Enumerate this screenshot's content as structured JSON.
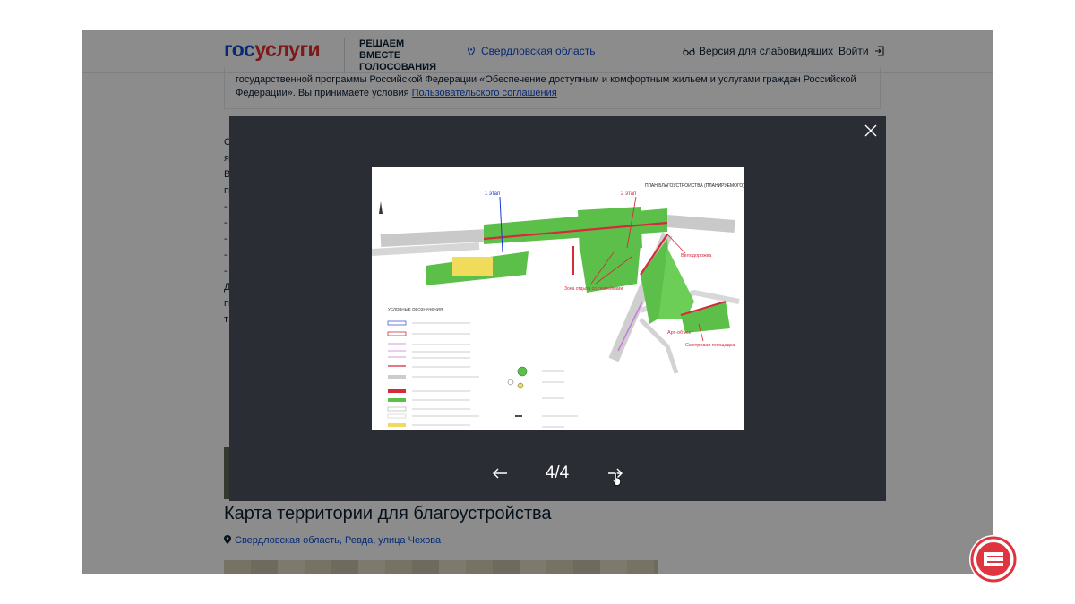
{
  "header": {
    "logo_part1": "гос",
    "logo_part2": "услуги",
    "slogan": "РЕШАЕМ ВМЕСТЕ ГОЛОСОВАНИЯ",
    "region": "Свердловская область",
    "accessibility": "Версия для слабовидящих",
    "login": "Войти"
  },
  "content": {
    "notice_text": "государственной программы Российской Федерации «Обеспечение доступным и комфортным жильем и услугами граждан Российской Федерации». Вы принимаете условия",
    "notice_link": "Пользовательского соглашения",
    "left_letters": [
      "С",
      "я",
      "В",
      "п",
      "-",
      "-",
      "-",
      "-",
      "-",
      "Д",
      "п",
      "т"
    ],
    "section_title": "Карта территории для благоустройства",
    "address": "Свердловская область, Ревда, улица Чехова"
  },
  "viewer": {
    "counter": "4/4",
    "image": {
      "plan_title": "ПЛАН БЛАГОУСТРОЙСТВА (ПЛАНИРУЕМОГО)",
      "stage1": "1 этап",
      "stage2": "2 этап",
      "label_bike": "Велодорожка",
      "label_rest": "Зона отдыха со скамейками",
      "label_art": "Арт-объект",
      "label_view": "Смотровая площадка",
      "legend_title": "УСЛОВНЫЕ ОБОЗНАЧЕНИЯ"
    }
  },
  "colors": {
    "brand_blue": "#0d4cd3",
    "brand_red": "#e52e2e",
    "modal_bg": "#2a2d33",
    "plan_green": "#5cbf4a",
    "plan_red": "#d8283c"
  },
  "icons": [
    "location-pin-icon",
    "glasses-icon",
    "exit-icon",
    "close-icon",
    "arrow-left-icon",
    "arrow-right-icon",
    "hand-cursor-icon"
  ]
}
